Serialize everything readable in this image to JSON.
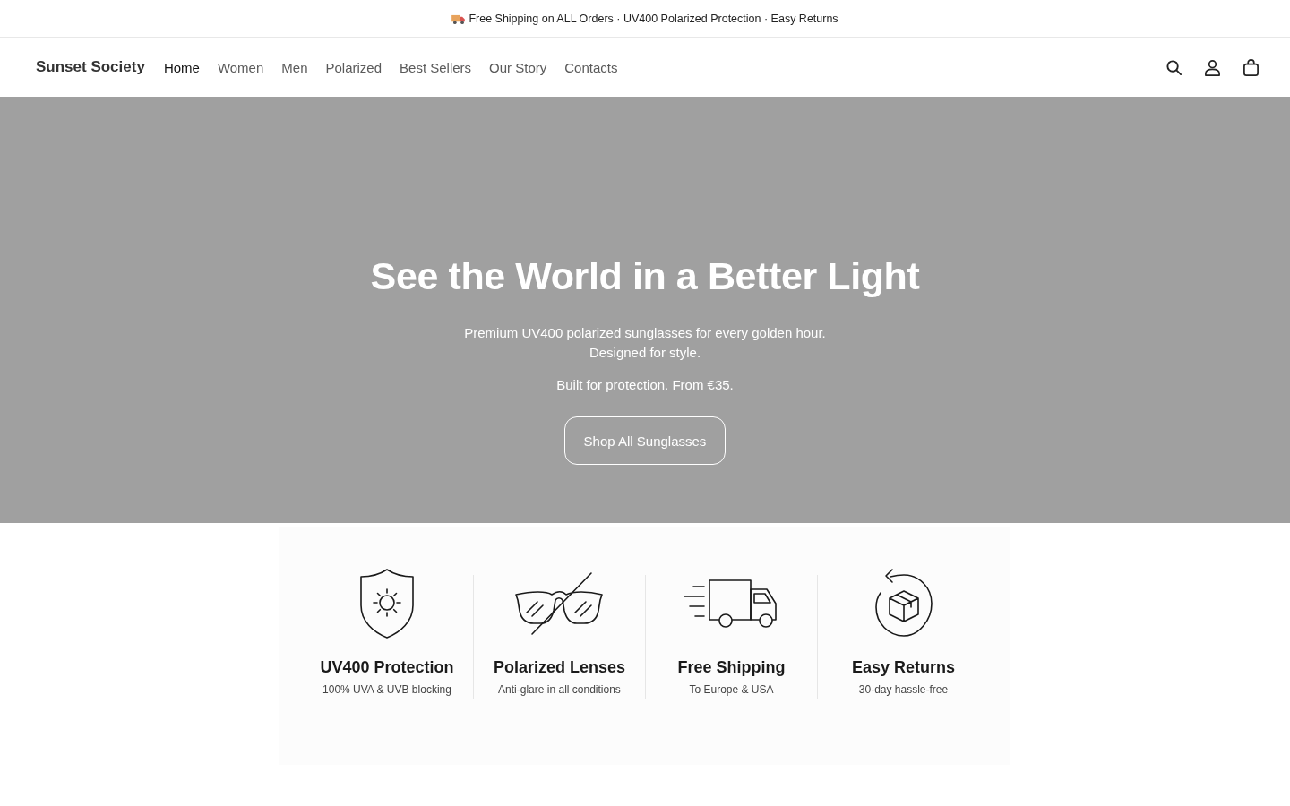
{
  "announcement": {
    "text": "Free Shipping on ALL Orders · UV400 Polarized Protection · Easy Returns"
  },
  "header": {
    "logo": "Sunset Society",
    "nav": [
      {
        "label": "Home",
        "selected": true
      },
      {
        "label": "Women",
        "selected": false
      },
      {
        "label": "Men",
        "selected": false
      },
      {
        "label": "Polarized",
        "selected": false
      },
      {
        "label": "Best Sellers",
        "selected": false
      },
      {
        "label": "Our Story",
        "selected": false
      },
      {
        "label": "Contacts",
        "selected": false
      }
    ]
  },
  "hero": {
    "title": "See the World in a Better Light",
    "subtitle": "Premium UV400 polarized sunglasses for every golden hour. Designed for style.",
    "tagline": "Built for protection. From €35.",
    "button": "Shop All Sunglasses"
  },
  "features": [
    {
      "kind": "shield",
      "title": "UV400 Protection",
      "subtitle": "100% UVA & UVB blocking"
    },
    {
      "kind": "glasses",
      "title": "Polarized Lenses",
      "subtitle": "Anti-glare in all conditions"
    },
    {
      "kind": "truck",
      "title": "Free Shipping",
      "subtitle": "To Europe & USA"
    },
    {
      "kind": "returns",
      "title": "Easy Returns",
      "subtitle": "30-day hassle-free"
    }
  ]
}
